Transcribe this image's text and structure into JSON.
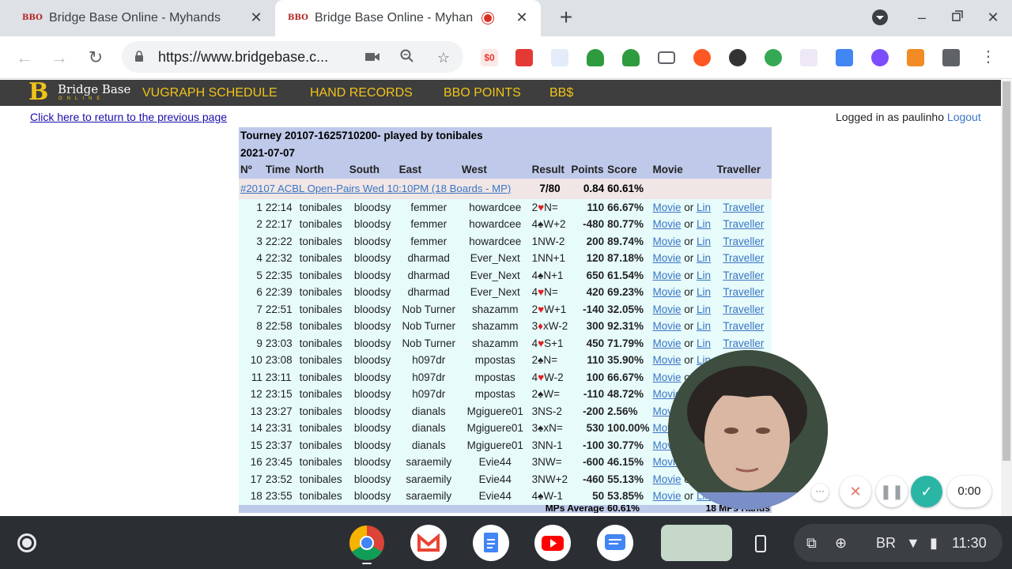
{
  "browser": {
    "tabs": [
      {
        "favicon": "BBO",
        "title": "Bridge Base Online - Myhands",
        "active": false
      },
      {
        "favicon": "BBO",
        "title": "Bridge Base Online - Myhands",
        "active": true,
        "recording": true
      }
    ],
    "url": "https://www.bridgebase.c...",
    "icons": {
      "back": "arrow-left-icon",
      "forward": "arrow-right-icon",
      "reload": "reload-icon",
      "camera": "camera-icon",
      "zoom": "zoom-icon",
      "bookmark": "star-icon",
      "extensions": "puzzle-icon",
      "menu": "kebab-menu-icon"
    }
  },
  "bbo": {
    "logo_text": "Bridge Base",
    "logo_sub": "ONLINE",
    "nav": [
      "VUGRAPH SCHEDULE",
      "HAND RECORDS",
      "BBO POINTS",
      "BB$"
    ],
    "return_link": "Click here to return to the previous page",
    "logged_in_label": "Logged in as paulinho",
    "logout_label": "Logout"
  },
  "results": {
    "title": "Tourney 20107-1625710200- played by tonibales",
    "date": "2021-07-07",
    "columns": [
      "Nº",
      "Time",
      "North",
      "South",
      "East",
      "West",
      "Result",
      "Points",
      "Score",
      "Movie",
      "Traveller"
    ],
    "event": {
      "name": "#20107 ACBL Open-Pairs Wed 10:10PM (18 Boards - MP)",
      "result": "7/80",
      "points": "0.84",
      "score": "60.61%"
    },
    "movie_label": "Movie",
    "or_label": "or",
    "lin_label": "Lin",
    "traveller_label": "Traveller",
    "rows": [
      {
        "n": "1",
        "time": "22:14",
        "north": "tonibales",
        "south": "bloodsy",
        "east": "femmer",
        "west": "howardcee",
        "contract": "2",
        "suit": "♥",
        "red": true,
        "rest": "N=",
        "points": "110",
        "neg": false,
        "score": "66.67%",
        "score_neg": false
      },
      {
        "n": "2",
        "time": "22:17",
        "north": "tonibales",
        "south": "bloodsy",
        "east": "femmer",
        "west": "howardcee",
        "contract": "4",
        "suit": "♠",
        "red": false,
        "rest": "W+2",
        "points": "-480",
        "neg": true,
        "score": "80.77%",
        "score_neg": false
      },
      {
        "n": "3",
        "time": "22:22",
        "north": "tonibales",
        "south": "bloodsy",
        "east": "femmer",
        "west": "howardcee",
        "contract": "1NW-2",
        "suit": "",
        "red": false,
        "rest": "",
        "points": "200",
        "neg": false,
        "score": "89.74%",
        "score_neg": false
      },
      {
        "n": "4",
        "time": "22:32",
        "north": "tonibales",
        "south": "bloodsy",
        "east": "dharmad",
        "west": "Ever_Next",
        "contract": "1NN+1",
        "suit": "",
        "red": false,
        "rest": "",
        "points": "120",
        "neg": false,
        "score": "87.18%",
        "score_neg": false
      },
      {
        "n": "5",
        "time": "22:35",
        "north": "tonibales",
        "south": "bloodsy",
        "east": "dharmad",
        "west": "Ever_Next",
        "contract": "4",
        "suit": "♠",
        "red": false,
        "rest": "N+1",
        "points": "650",
        "neg": false,
        "score": "61.54%",
        "score_neg": false
      },
      {
        "n": "6",
        "time": "22:39",
        "north": "tonibales",
        "south": "bloodsy",
        "east": "dharmad",
        "west": "Ever_Next",
        "contract": "4",
        "suit": "♥",
        "red": true,
        "rest": "N=",
        "points": "420",
        "neg": false,
        "score": "69.23%",
        "score_neg": false
      },
      {
        "n": "7",
        "time": "22:51",
        "north": "tonibales",
        "south": "bloodsy",
        "east": "Nob Turner",
        "west": "shazamm",
        "contract": "2",
        "suit": "♥",
        "red": true,
        "rest": "W+1",
        "points": "-140",
        "neg": true,
        "score": "32.05%",
        "score_neg": true
      },
      {
        "n": "8",
        "time": "22:58",
        "north": "tonibales",
        "south": "bloodsy",
        "east": "Nob Turner",
        "west": "shazamm",
        "contract": "3",
        "suit": "♦",
        "red": true,
        "rest": "xW-2",
        "points": "300",
        "neg": false,
        "score": "92.31%",
        "score_neg": false
      },
      {
        "n": "9",
        "time": "23:03",
        "north": "tonibales",
        "south": "bloodsy",
        "east": "Nob Turner",
        "west": "shazamm",
        "contract": "4",
        "suit": "♥",
        "red": true,
        "rest": "S+1",
        "points": "450",
        "neg": false,
        "score": "71.79%",
        "score_neg": false
      },
      {
        "n": "10",
        "time": "23:08",
        "north": "tonibales",
        "south": "bloodsy",
        "east": "h097dr",
        "west": "mpostas",
        "contract": "2",
        "suit": "♠",
        "red": false,
        "rest": "N=",
        "points": "110",
        "neg": false,
        "score": "35.90%",
        "score_neg": true
      },
      {
        "n": "11",
        "time": "23:11",
        "north": "tonibales",
        "south": "bloodsy",
        "east": "h097dr",
        "west": "mpostas",
        "contract": "4",
        "suit": "♥",
        "red": true,
        "rest": "W-2",
        "points": "100",
        "neg": false,
        "score": "66.67%",
        "score_neg": false
      },
      {
        "n": "12",
        "time": "23:15",
        "north": "tonibales",
        "south": "bloodsy",
        "east": "h097dr",
        "west": "mpostas",
        "contract": "2",
        "suit": "♠",
        "red": false,
        "rest": "W=",
        "points": "-110",
        "neg": true,
        "score": "48.72%",
        "score_neg": true
      },
      {
        "n": "13",
        "time": "23:27",
        "north": "tonibales",
        "south": "bloodsy",
        "east": "dianals",
        "west": "Mgiguere01",
        "contract": "3NS-2",
        "suit": "",
        "red": false,
        "rest": "",
        "points": "-200",
        "neg": true,
        "score": "2.56%",
        "score_neg": true
      },
      {
        "n": "14",
        "time": "23:31",
        "north": "tonibales",
        "south": "bloodsy",
        "east": "dianals",
        "west": "Mgiguere01",
        "contract": "3",
        "suit": "♠",
        "red": false,
        "rest": "xN=",
        "points": "530",
        "neg": false,
        "score": "100.00%",
        "score_neg": false
      },
      {
        "n": "15",
        "time": "23:37",
        "north": "tonibales",
        "south": "bloodsy",
        "east": "dianals",
        "west": "Mgiguere01",
        "contract": "3NN-1",
        "suit": "",
        "red": false,
        "rest": "",
        "points": "-100",
        "neg": true,
        "score": "30.77%",
        "score_neg": true
      },
      {
        "n": "16",
        "time": "23:45",
        "north": "tonibales",
        "south": "bloodsy",
        "east": "saraemily",
        "west": "Evie44",
        "contract": "3NW=",
        "suit": "",
        "red": false,
        "rest": "",
        "points": "-600",
        "neg": true,
        "score": "46.15%",
        "score_neg": true
      },
      {
        "n": "17",
        "time": "23:52",
        "north": "tonibales",
        "south": "bloodsy",
        "east": "saraemily",
        "west": "Evie44",
        "contract": "3NW+2",
        "suit": "",
        "red": false,
        "rest": "",
        "points": "-460",
        "neg": true,
        "score": "55.13%",
        "score_neg": false
      },
      {
        "n": "18",
        "time": "23:55",
        "north": "tonibales",
        "south": "bloodsy",
        "east": "saraemily",
        "west": "Evie44",
        "contract": "4",
        "suit": "♠",
        "red": false,
        "rest": "W-1",
        "points": "50",
        "neg": false,
        "score": "53.85%",
        "score_neg": false
      }
    ],
    "footer": {
      "avg_label": "MPs Average",
      "avg_value": "60.61%",
      "hands_label": "18 MPs Hands"
    }
  },
  "recorder": {
    "timer": "0:00"
  },
  "shelf": {
    "apps": [
      "chrome-icon",
      "gmail-icon",
      "docs-icon",
      "youtube-icon",
      "messages-icon",
      "window-thumbnail"
    ],
    "tray": {
      "keyboard": "BR",
      "time": "11:30"
    }
  },
  "colors": {
    "bbo_yellow": "#f0c319",
    "header_blue": "#bfc9ea",
    "row_cyan": "#e7fbfb",
    "event_pink": "#f0e6e6",
    "negative_red": "#e02020",
    "link_blue": "#3a75c4"
  }
}
